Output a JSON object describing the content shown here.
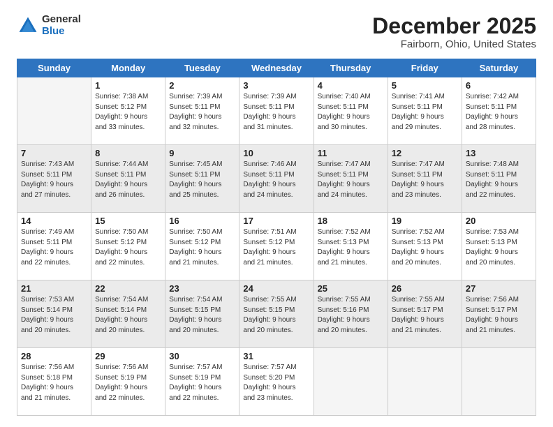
{
  "header": {
    "logo_general": "General",
    "logo_blue": "Blue",
    "month": "December 2025",
    "location": "Fairborn, Ohio, United States"
  },
  "weekdays": [
    "Sunday",
    "Monday",
    "Tuesday",
    "Wednesday",
    "Thursday",
    "Friday",
    "Saturday"
  ],
  "weeks": [
    [
      {
        "day": "",
        "info": "",
        "empty": true
      },
      {
        "day": "1",
        "info": "Sunrise: 7:38 AM\nSunset: 5:12 PM\nDaylight: 9 hours\nand 33 minutes."
      },
      {
        "day": "2",
        "info": "Sunrise: 7:39 AM\nSunset: 5:11 PM\nDaylight: 9 hours\nand 32 minutes."
      },
      {
        "day": "3",
        "info": "Sunrise: 7:39 AM\nSunset: 5:11 PM\nDaylight: 9 hours\nand 31 minutes."
      },
      {
        "day": "4",
        "info": "Sunrise: 7:40 AM\nSunset: 5:11 PM\nDaylight: 9 hours\nand 30 minutes."
      },
      {
        "day": "5",
        "info": "Sunrise: 7:41 AM\nSunset: 5:11 PM\nDaylight: 9 hours\nand 29 minutes."
      },
      {
        "day": "6",
        "info": "Sunrise: 7:42 AM\nSunset: 5:11 PM\nDaylight: 9 hours\nand 28 minutes."
      }
    ],
    [
      {
        "day": "7",
        "info": "Sunrise: 7:43 AM\nSunset: 5:11 PM\nDaylight: 9 hours\nand 27 minutes."
      },
      {
        "day": "8",
        "info": "Sunrise: 7:44 AM\nSunset: 5:11 PM\nDaylight: 9 hours\nand 26 minutes."
      },
      {
        "day": "9",
        "info": "Sunrise: 7:45 AM\nSunset: 5:11 PM\nDaylight: 9 hours\nand 25 minutes."
      },
      {
        "day": "10",
        "info": "Sunrise: 7:46 AM\nSunset: 5:11 PM\nDaylight: 9 hours\nand 24 minutes."
      },
      {
        "day": "11",
        "info": "Sunrise: 7:47 AM\nSunset: 5:11 PM\nDaylight: 9 hours\nand 24 minutes."
      },
      {
        "day": "12",
        "info": "Sunrise: 7:47 AM\nSunset: 5:11 PM\nDaylight: 9 hours\nand 23 minutes."
      },
      {
        "day": "13",
        "info": "Sunrise: 7:48 AM\nSunset: 5:11 PM\nDaylight: 9 hours\nand 22 minutes."
      }
    ],
    [
      {
        "day": "14",
        "info": "Sunrise: 7:49 AM\nSunset: 5:11 PM\nDaylight: 9 hours\nand 22 minutes."
      },
      {
        "day": "15",
        "info": "Sunrise: 7:50 AM\nSunset: 5:12 PM\nDaylight: 9 hours\nand 22 minutes."
      },
      {
        "day": "16",
        "info": "Sunrise: 7:50 AM\nSunset: 5:12 PM\nDaylight: 9 hours\nand 21 minutes."
      },
      {
        "day": "17",
        "info": "Sunrise: 7:51 AM\nSunset: 5:12 PM\nDaylight: 9 hours\nand 21 minutes."
      },
      {
        "day": "18",
        "info": "Sunrise: 7:52 AM\nSunset: 5:13 PM\nDaylight: 9 hours\nand 21 minutes."
      },
      {
        "day": "19",
        "info": "Sunrise: 7:52 AM\nSunset: 5:13 PM\nDaylight: 9 hours\nand 20 minutes."
      },
      {
        "day": "20",
        "info": "Sunrise: 7:53 AM\nSunset: 5:13 PM\nDaylight: 9 hours\nand 20 minutes."
      }
    ],
    [
      {
        "day": "21",
        "info": "Sunrise: 7:53 AM\nSunset: 5:14 PM\nDaylight: 9 hours\nand 20 minutes."
      },
      {
        "day": "22",
        "info": "Sunrise: 7:54 AM\nSunset: 5:14 PM\nDaylight: 9 hours\nand 20 minutes."
      },
      {
        "day": "23",
        "info": "Sunrise: 7:54 AM\nSunset: 5:15 PM\nDaylight: 9 hours\nand 20 minutes."
      },
      {
        "day": "24",
        "info": "Sunrise: 7:55 AM\nSunset: 5:15 PM\nDaylight: 9 hours\nand 20 minutes."
      },
      {
        "day": "25",
        "info": "Sunrise: 7:55 AM\nSunset: 5:16 PM\nDaylight: 9 hours\nand 20 minutes."
      },
      {
        "day": "26",
        "info": "Sunrise: 7:55 AM\nSunset: 5:17 PM\nDaylight: 9 hours\nand 21 minutes."
      },
      {
        "day": "27",
        "info": "Sunrise: 7:56 AM\nSunset: 5:17 PM\nDaylight: 9 hours\nand 21 minutes."
      }
    ],
    [
      {
        "day": "28",
        "info": "Sunrise: 7:56 AM\nSunset: 5:18 PM\nDaylight: 9 hours\nand 21 minutes."
      },
      {
        "day": "29",
        "info": "Sunrise: 7:56 AM\nSunset: 5:19 PM\nDaylight: 9 hours\nand 22 minutes."
      },
      {
        "day": "30",
        "info": "Sunrise: 7:57 AM\nSunset: 5:19 PM\nDaylight: 9 hours\nand 22 minutes."
      },
      {
        "day": "31",
        "info": "Sunrise: 7:57 AM\nSunset: 5:20 PM\nDaylight: 9 hours\nand 23 minutes."
      },
      {
        "day": "",
        "info": "",
        "empty": true
      },
      {
        "day": "",
        "info": "",
        "empty": true
      },
      {
        "day": "",
        "info": "",
        "empty": true
      }
    ]
  ]
}
